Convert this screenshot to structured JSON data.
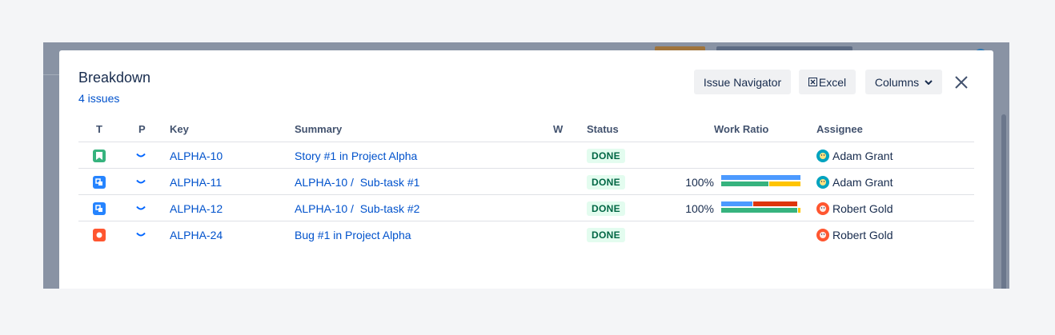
{
  "dialog": {
    "title": "Breakdown",
    "issue_count": "4 issues",
    "buttons": {
      "issue_navigator": "Issue Navigator",
      "excel": "Excel",
      "columns": "Columns"
    }
  },
  "table": {
    "headers": {
      "t": "T",
      "p": "P",
      "key": "Key",
      "summary": "Summary",
      "w": "W",
      "status": "Status",
      "work_ratio": "Work Ratio",
      "assignee": "Assignee"
    },
    "rows": [
      {
        "type": "story-icon",
        "type_color": "#36b37e",
        "priority": "low-priority-icon",
        "key": "ALPHA-10",
        "summary": "Story #1 in Project Alpha",
        "status": "DONE",
        "work_ratio": "",
        "assignee": "Adam Grant",
        "avatar_color": "#00a3bf"
      },
      {
        "type": "subtask-icon",
        "type_color": "#2684ff",
        "priority": "low-priority-icon",
        "key": "ALPHA-11",
        "summary": "ALPHA-10 /  Sub-task #1",
        "status": "DONE",
        "work_ratio": "100%",
        "assignee": "Adam Grant",
        "avatar_color": "#00a3bf",
        "ratio_bars": {
          "top": [
            {
              "color": "#4c9aff",
              "fraction": 1.0
            }
          ],
          "bottom": [
            {
              "color": "#36b37e",
              "fraction": 0.6
            },
            {
              "color": "#ffc400",
              "fraction": 0.4
            }
          ]
        }
      },
      {
        "type": "subtask-icon",
        "type_color": "#2684ff",
        "priority": "low-priority-icon",
        "key": "ALPHA-12",
        "summary": "ALPHA-10 /  Sub-task #2",
        "status": "DONE",
        "work_ratio": "100%",
        "assignee": "Robert Gold",
        "avatar_color": "#ff5630",
        "ratio_bars": {
          "top": [
            {
              "color": "#4c9aff",
              "fraction": 0.4
            },
            {
              "color": "#de350b",
              "fraction": 0.56
            }
          ],
          "bottom": [
            {
              "color": "#36b37e",
              "fraction": 0.96
            },
            {
              "color": "#ffc400",
              "fraction": 0.04
            }
          ]
        }
      },
      {
        "type": "bug-icon",
        "type_color": "#ff5630",
        "priority": "low-priority-icon",
        "key": "ALPHA-24",
        "summary": "Bug #1 in Project Alpha",
        "status": "DONE",
        "work_ratio": "",
        "assignee": "Robert Gold",
        "avatar_color": "#ff5630"
      }
    ]
  },
  "colors": {
    "link": "#0052cc",
    "done_badge_bg": "#e3fcef",
    "done_badge_text": "#006644"
  }
}
